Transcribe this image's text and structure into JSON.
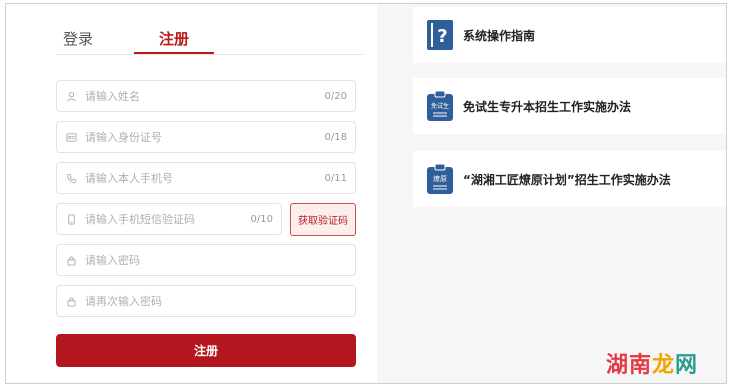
{
  "tabs": {
    "login": "登录",
    "register": "注册"
  },
  "fields": [
    {
      "icon": "user-icon",
      "placeholder": "请输入姓名",
      "counter": "0/20"
    },
    {
      "icon": "id-card-icon",
      "placeholder": "请输入身份证号",
      "counter": "0/18"
    },
    {
      "icon": "phone-icon",
      "placeholder": "请输入本人手机号",
      "counter": "0/11"
    },
    {
      "icon": "mobile-icon",
      "placeholder": "请输入手机短信验证码",
      "counter": "0/10"
    },
    {
      "icon": "lock-icon",
      "placeholder": "请输入密码",
      "counter": ""
    },
    {
      "icon": "lock-icon",
      "placeholder": "请再次输入密码",
      "counter": ""
    }
  ],
  "code_button": "获取验证码",
  "submit_label": "注册",
  "guides": [
    {
      "icon": "question-icon",
      "icon_text": "",
      "title": "系统操作指南"
    },
    {
      "icon": "clipboard-icon",
      "icon_text": "免试生",
      "title": "免试生专升本招生工作实施办法"
    },
    {
      "icon": "clipboard-icon",
      "icon_text": "燎原",
      "title": "“湖湘工匠燎原计划”招生工作实施办法"
    }
  ],
  "watermark": {
    "part1": "湖南",
    "part2": "龙",
    "part3": "网"
  },
  "colors": {
    "brand": "#b3161f",
    "icon_blue": "#2f5f9b"
  }
}
